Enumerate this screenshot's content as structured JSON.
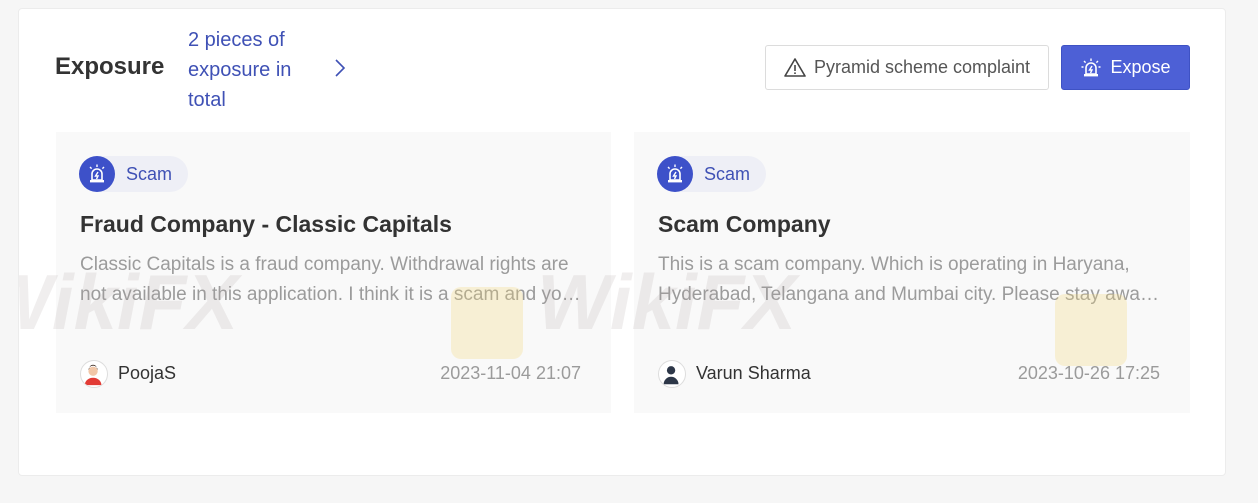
{
  "header": {
    "title": "Exposure",
    "count_link": "2 pieces of exposure in total"
  },
  "actions": {
    "complaint_label": "Pyramid scheme complaint",
    "expose_label": "Expose"
  },
  "cards": [
    {
      "tag": "Scam",
      "title": "Fraud Company - Classic Capitals",
      "body": "Classic Capitals is a fraud company. Withdrawal rights are not available in this application. I think it is a scam and you should not trust it.",
      "author": "PoojaS",
      "date": "2023-11-04 21:07"
    },
    {
      "tag": "Scam",
      "title": "Scam Company",
      "body": "This is a scam company. Which is operating in Haryana, Hyderabad, Telangana and Mumbai city. Please stay away from it.",
      "author": "Varun Sharma",
      "date": "2023-10-26 17:25"
    }
  ],
  "watermark": {
    "text": "WikiFX"
  },
  "colors": {
    "accent": "#3f51b5",
    "expose_button": "#4d60d6",
    "card_bg": "#f9f9f9"
  },
  "icons": {
    "complaint": "warning-triangle-icon",
    "expose": "alarm-siren-icon",
    "tag": "alarm-siren-icon",
    "chevron": "chevron-right-icon"
  }
}
